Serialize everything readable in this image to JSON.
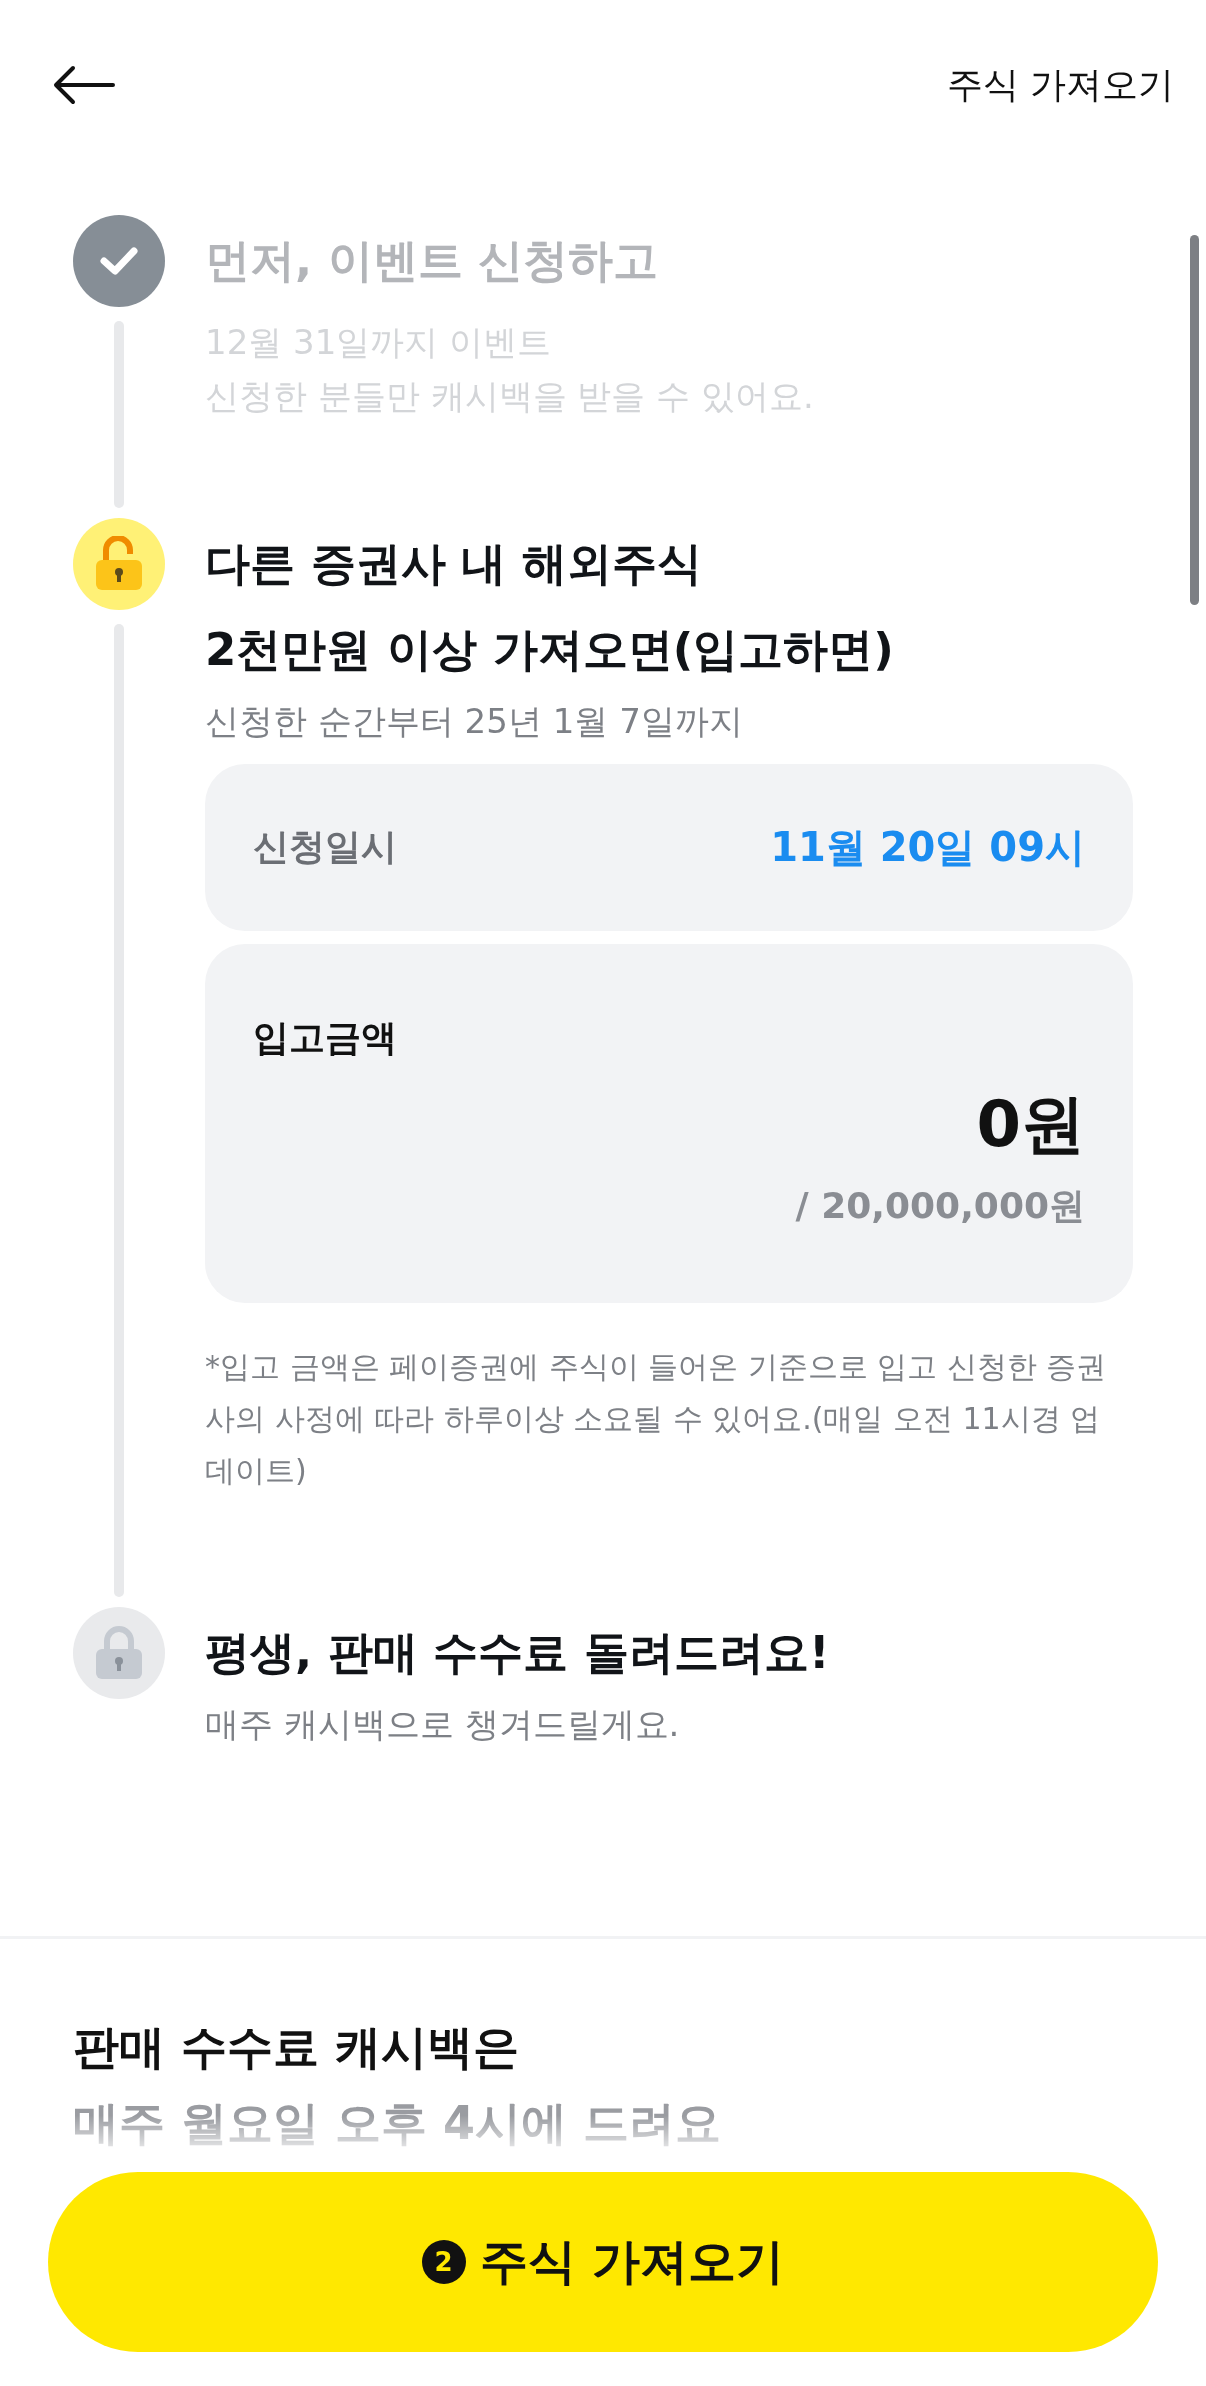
{
  "header": {
    "title": "주식 가져오기"
  },
  "steps": [
    {
      "kind": "done",
      "title_lines": [
        "먼저, 이벤트 신청하고"
      ],
      "lines": [
        "12월 31일까지 이벤트",
        "신청한 분들만 캐시백을 받을 수 있어요."
      ]
    },
    {
      "kind": "active",
      "title_lines": [
        "다른 증권사 내 해외주식",
        "2천만원 이상 가져오면(입고하면)"
      ],
      "lines": [
        "신청한 순간부터 25년 1월 7일까지"
      ],
      "date_card": {
        "label": "신청일시",
        "value": "11월 20일 09시"
      },
      "amount_card": {
        "label": "입고금액",
        "amount": "0원",
        "target": "/ 20,000,000원"
      },
      "note": "*입고 금액은 페이증권에 주식이 들어온 기준으로 입고 신청한 증권사의 사정에 따라 하루이상 소요될 수 있어요.(매일 오전 11시경 업데이트)"
    },
    {
      "kind": "locked",
      "title_lines": [
        "평생, 판매 수수료 돌려드려요!"
      ],
      "lines": [
        "매주 캐시백으로 챙겨드릴게요."
      ]
    }
  ],
  "info": {
    "title": "판매 수수료 캐시백은",
    "subtitle": "매주 월요일 오후 4시에 드려요"
  },
  "cta": {
    "badge": "2",
    "label": "주식 가져오기"
  }
}
